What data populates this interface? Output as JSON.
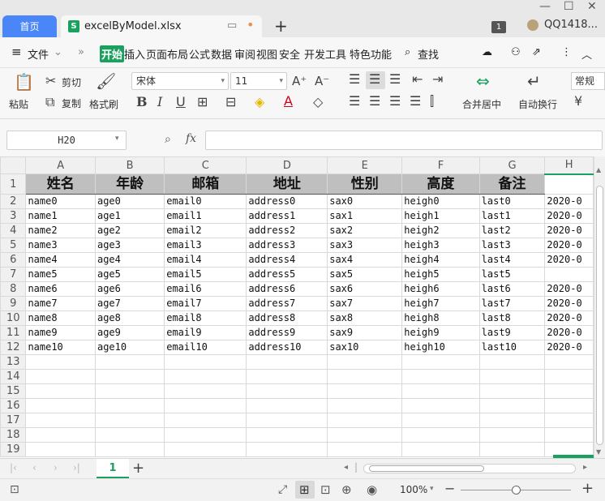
{
  "tabs": {
    "home": "首页",
    "file": "excelByModel.xlsx",
    "file_icon_letter": "S",
    "badge": "1",
    "user": "QQ1418..."
  },
  "menu": {
    "file_label": "文件",
    "items": [
      "开始",
      "插入",
      "页面布局",
      "公式",
      "数据",
      "审阅",
      "视图",
      "安全",
      "开发工具",
      "特色功能"
    ],
    "search": "查找"
  },
  "ribbon": {
    "paste": "粘贴",
    "cut": "剪切",
    "copy": "复制",
    "format_painter": "格式刷",
    "font_name": "宋体",
    "font_size": "11",
    "merge_center": "合并居中",
    "wrap_text": "自动换行",
    "number_format": "常规",
    "font_grow": "A⁺",
    "font_shrink": "A⁻"
  },
  "formula": {
    "cell_ref": "H20",
    "fx": "fx",
    "value": ""
  },
  "grid": {
    "columns": [
      "A",
      "B",
      "C",
      "D",
      "E",
      "F",
      "G",
      "H"
    ],
    "header_row": [
      "姓名",
      "年龄",
      "邮箱",
      "地址",
      "性别",
      "高度",
      "备注",
      ""
    ],
    "rows": [
      [
        "name0",
        "age0",
        "email0",
        "address0",
        "sax0",
        "heigh0",
        "last0",
        "2020-0"
      ],
      [
        "name1",
        "age1",
        "email1",
        "address1",
        "sax1",
        "heigh1",
        "last1",
        "2020-0"
      ],
      [
        "name2",
        "age2",
        "email2",
        "address2",
        "sax2",
        "heigh2",
        "last2",
        "2020-0"
      ],
      [
        "name3",
        "age3",
        "email3",
        "address3",
        "sax3",
        "heigh3",
        "last3",
        "2020-0"
      ],
      [
        "name4",
        "age4",
        "email4",
        "address4",
        "sax4",
        "heigh4",
        "last4",
        "2020-0"
      ],
      [
        "name5",
        "age5",
        "email5",
        "address5",
        "sax5",
        "heigh5",
        "last5",
        ""
      ],
      [
        "name6",
        "age6",
        "email6",
        "address6",
        "sax6",
        "heigh6",
        "last6",
        "2020-0"
      ],
      [
        "name7",
        "age7",
        "email7",
        "address7",
        "sax7",
        "heigh7",
        "last7",
        "2020-0"
      ],
      [
        "name8",
        "age8",
        "email8",
        "address8",
        "sax8",
        "heigh8",
        "last8",
        "2020-0"
      ],
      [
        "name9",
        "age9",
        "email9",
        "address9",
        "sax9",
        "heigh9",
        "last9",
        "2020-0"
      ],
      [
        "name10",
        "age10",
        "email10",
        "address10",
        "sax10",
        "heigh10",
        "last10",
        "2020-0"
      ]
    ],
    "row_numbers": [
      "1",
      "2",
      "3",
      "4",
      "5",
      "6",
      "7",
      "8",
      "9",
      "10",
      "11",
      "12",
      "13",
      "14",
      "15",
      "16",
      "17",
      "18",
      "19"
    ]
  },
  "sheets": [
    "1"
  ],
  "status": {
    "zoom": "100%"
  },
  "colors": {
    "accent": "#1aa15f",
    "home_tab": "#4a86f7",
    "header_fill": "#bfbfbf"
  }
}
